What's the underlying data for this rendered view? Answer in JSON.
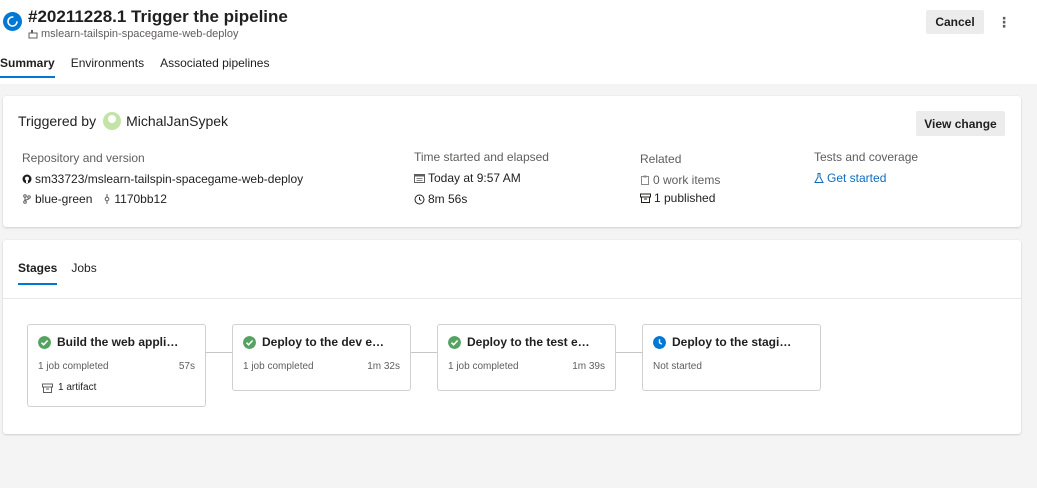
{
  "header": {
    "title": "#20211228.1 Trigger the pipeline",
    "repo_name": "mslearn-tailspin-spacegame-web-deploy",
    "cancel_label": "Cancel",
    "more_label": "⋮",
    "tabs": [
      {
        "label": "Summary"
      },
      {
        "label": "Environments"
      },
      {
        "label": "Associated pipelines"
      }
    ]
  },
  "summary": {
    "triggered_by_label": "Triggered by",
    "user": "MichalJanSypek",
    "view_change_label": "View change",
    "repository": {
      "label": "Repository and version",
      "repo": "sm33723/mslearn-tailspin-spacegame-web-deploy",
      "branch": "blue-green",
      "commit": "1170bb12"
    },
    "time": {
      "label": "Time started and elapsed",
      "started": "Today at 9:57 AM",
      "elapsed": "8m 56s"
    },
    "related": {
      "label": "Related",
      "work_items": "0 work items",
      "published": "1 published"
    },
    "tests": {
      "label": "Tests and coverage",
      "link": "Get started"
    }
  },
  "stages_panel": {
    "tabs": [
      {
        "label": "Stages"
      },
      {
        "label": "Jobs"
      }
    ],
    "stages": [
      {
        "name": "Build the web appli…",
        "status": "succeeded",
        "jobs": "1 job completed",
        "duration": "57s",
        "artifact": "1 artifact"
      },
      {
        "name": "Deploy to the dev e…",
        "status": "succeeded",
        "jobs": "1 job completed",
        "duration": "1m 32s"
      },
      {
        "name": "Deploy to the test e…",
        "status": "succeeded",
        "jobs": "1 job completed",
        "duration": "1m 39s"
      },
      {
        "name": "Deploy to the stagi…",
        "status": "not-started",
        "jobs": "Not started",
        "duration": ""
      }
    ]
  },
  "colors": {
    "accent": "#0078d4",
    "success": "#55a362",
    "link": "#0f6cbd"
  }
}
